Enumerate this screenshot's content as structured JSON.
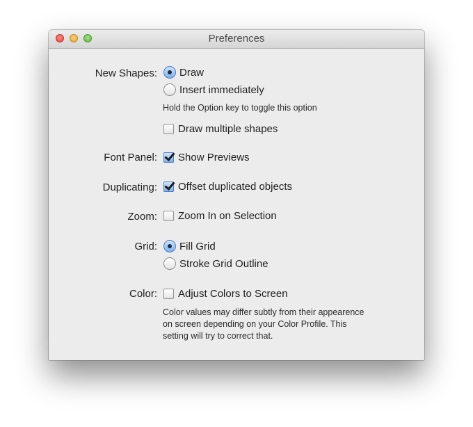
{
  "window": {
    "title": "Preferences"
  },
  "new_shapes": {
    "label": "New Shapes:",
    "options": [
      {
        "label": "Draw",
        "selected": true
      },
      {
        "label": "Insert immediately",
        "selected": false
      }
    ],
    "hint": "Hold the Option key to toggle this option",
    "multiple": {
      "label": "Draw multiple shapes",
      "checked": false
    }
  },
  "font_panel": {
    "label": "Font Panel:",
    "show_previews": {
      "label": "Show Previews",
      "checked": true
    }
  },
  "duplicating": {
    "label": "Duplicating:",
    "offset": {
      "label": "Offset duplicated objects",
      "checked": true
    }
  },
  "zoom": {
    "label": "Zoom:",
    "zoom_in": {
      "label": "Zoom In on Selection",
      "checked": false
    }
  },
  "grid": {
    "label": "Grid:",
    "options": [
      {
        "label": "Fill Grid",
        "selected": true
      },
      {
        "label": "Stroke Grid Outline",
        "selected": false
      }
    ]
  },
  "color": {
    "label": "Color:",
    "adjust": {
      "label": "Adjust Colors to Screen",
      "checked": false
    },
    "note_lines": [
      "Color values may differ subtly from their appearence",
      "on screen depending on your Color Profile. This",
      "setting will try to correct that."
    ]
  },
  "colors": {
    "accent_blue": "#4e7bc4",
    "close": "#e0443a",
    "minimize": "#e5a32b",
    "zoom": "#5fb240"
  }
}
